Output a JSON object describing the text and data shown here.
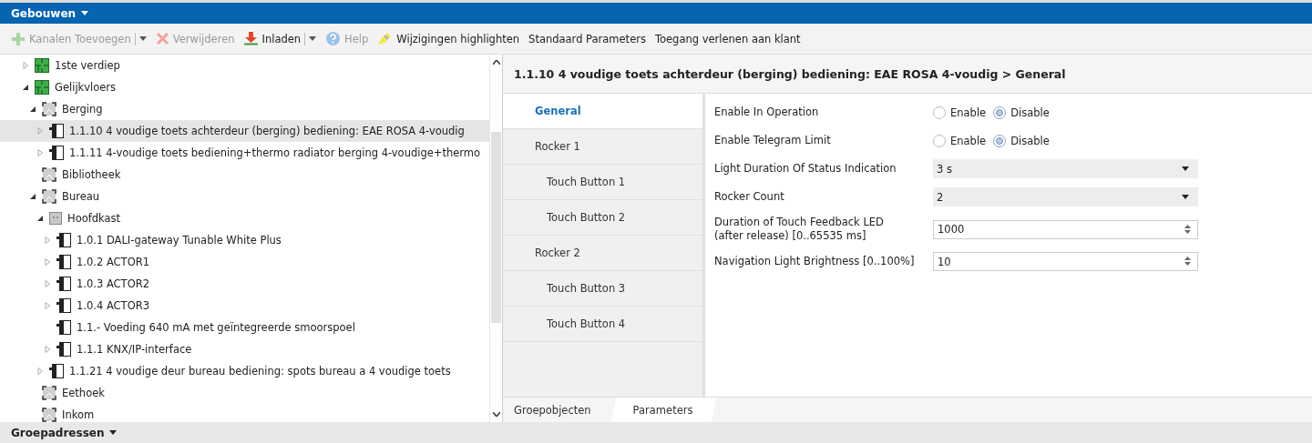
{
  "header": {
    "title": "Gebouwen"
  },
  "toolbar": [
    {
      "label": "Kanalen Toevoegen",
      "disabled": true,
      "dropdown": true
    },
    {
      "label": "Verwijderen",
      "disabled": true,
      "dropdown": false
    },
    {
      "label": "Inladen",
      "disabled": false,
      "dropdown": true
    },
    {
      "label": "Help",
      "disabled": true,
      "dropdown": false
    },
    {
      "label": "Wijzigingen highlighten",
      "disabled": false,
      "dropdown": false
    },
    {
      "label": "Standaard Parameters",
      "disabled": false,
      "dropdown": false
    },
    {
      "label": "Toegang verlenen aan klant",
      "disabled": false,
      "dropdown": false
    }
  ],
  "tree": [
    {
      "kind": "floor",
      "label": "1ste verdiep",
      "expanded": false,
      "selected": false
    },
    {
      "kind": "floor",
      "label": "Gelijkvloers",
      "expanded": true,
      "selected": false,
      "children": [
        {
          "kind": "room",
          "label": "Berging",
          "expanded": true,
          "selected": false,
          "children": [
            {
              "kind": "device",
              "label": "1.1.10 4 voudige toets achterdeur (berging) bediening: EAE ROSA 4-voudig",
              "expanded": false,
              "selected": true
            },
            {
              "kind": "device",
              "label": "1.1.11 4-voudige toets bediening+thermo radiator berging 4-voudige+thermo",
              "expanded": false,
              "selected": false
            }
          ]
        },
        {
          "kind": "room",
          "label": "Bibliotheek",
          "selected": false
        },
        {
          "kind": "room",
          "label": "Bureau",
          "expanded": true,
          "selected": false,
          "children": [
            {
              "kind": "cabinet",
              "label": "Hoofdkast",
              "expanded": true,
              "selected": false,
              "children": [
                {
                  "kind": "device",
                  "label": "1.0.1 DALI-gateway Tunable White Plus",
                  "expanded": false,
                  "selected": false
                },
                {
                  "kind": "device",
                  "label": "1.0.2 ACTOR1",
                  "expanded": false,
                  "selected": false
                },
                {
                  "kind": "device",
                  "label": "1.0.3 ACTOR2",
                  "expanded": false,
                  "selected": false
                },
                {
                  "kind": "device",
                  "label": "1.0.4 ACTOR3",
                  "expanded": false,
                  "selected": false
                },
                {
                  "kind": "device",
                  "label": "1.1.- Voeding 640 mA met geïntegreerde smoorspoel",
                  "selected": false
                },
                {
                  "kind": "device",
                  "label": "1.1.1 KNX/IP-interface",
                  "expanded": false,
                  "selected": false
                }
              ]
            },
            {
              "kind": "device",
              "label": "1.1.21 4 voudige deur bureau bediening: spots bureau a 4 voudige toets",
              "expanded": false,
              "selected": false
            }
          ]
        },
        {
          "kind": "room",
          "label": "Eethoek",
          "selected": false
        },
        {
          "kind": "room",
          "label": "Inkom",
          "selected": false
        }
      ]
    }
  ],
  "detail": {
    "title": "1.1.10 4 voudige toets achterdeur (berging) bediening: EAE ROSA 4-voudig > General",
    "nav": [
      {
        "label": "General",
        "selected": true,
        "sub": false
      },
      {
        "label": "Rocker 1",
        "selected": false,
        "sub": false
      },
      {
        "label": "Touch Button 1",
        "selected": false,
        "sub": true
      },
      {
        "label": "Touch Button 2",
        "selected": false,
        "sub": true
      },
      {
        "label": "Rocker 2",
        "selected": false,
        "sub": false
      },
      {
        "label": "Touch Button 3",
        "selected": false,
        "sub": true
      },
      {
        "label": "Touch Button 4",
        "selected": false,
        "sub": true
      }
    ],
    "params": [
      {
        "kind": "radio",
        "label": "Enable In Operation",
        "options": [
          {
            "label": "Enable",
            "selected": false
          },
          {
            "label": "Disable",
            "selected": true
          }
        ]
      },
      {
        "kind": "radio",
        "label": "Enable Telegram Limit",
        "options": [
          {
            "label": "Enable",
            "selected": false
          },
          {
            "label": "Disable",
            "selected": true
          }
        ]
      },
      {
        "kind": "select",
        "label": "Light Duration Of Status Indication",
        "value": "3 s"
      },
      {
        "kind": "select",
        "label": "Rocker Count",
        "value": "2"
      },
      {
        "kind": "number",
        "label": "Duration of Touch Feedback LED\n(after release) [0..65535 ms]",
        "value": "1000"
      },
      {
        "kind": "number",
        "label": "Navigation Light Brightness [0..100%]",
        "value": "10"
      }
    ],
    "tabs": [
      {
        "label": "Groepobjecten",
        "selected": false
      },
      {
        "label": "Parameters",
        "selected": true
      }
    ]
  },
  "footer": {
    "title": "Groepadressen"
  }
}
